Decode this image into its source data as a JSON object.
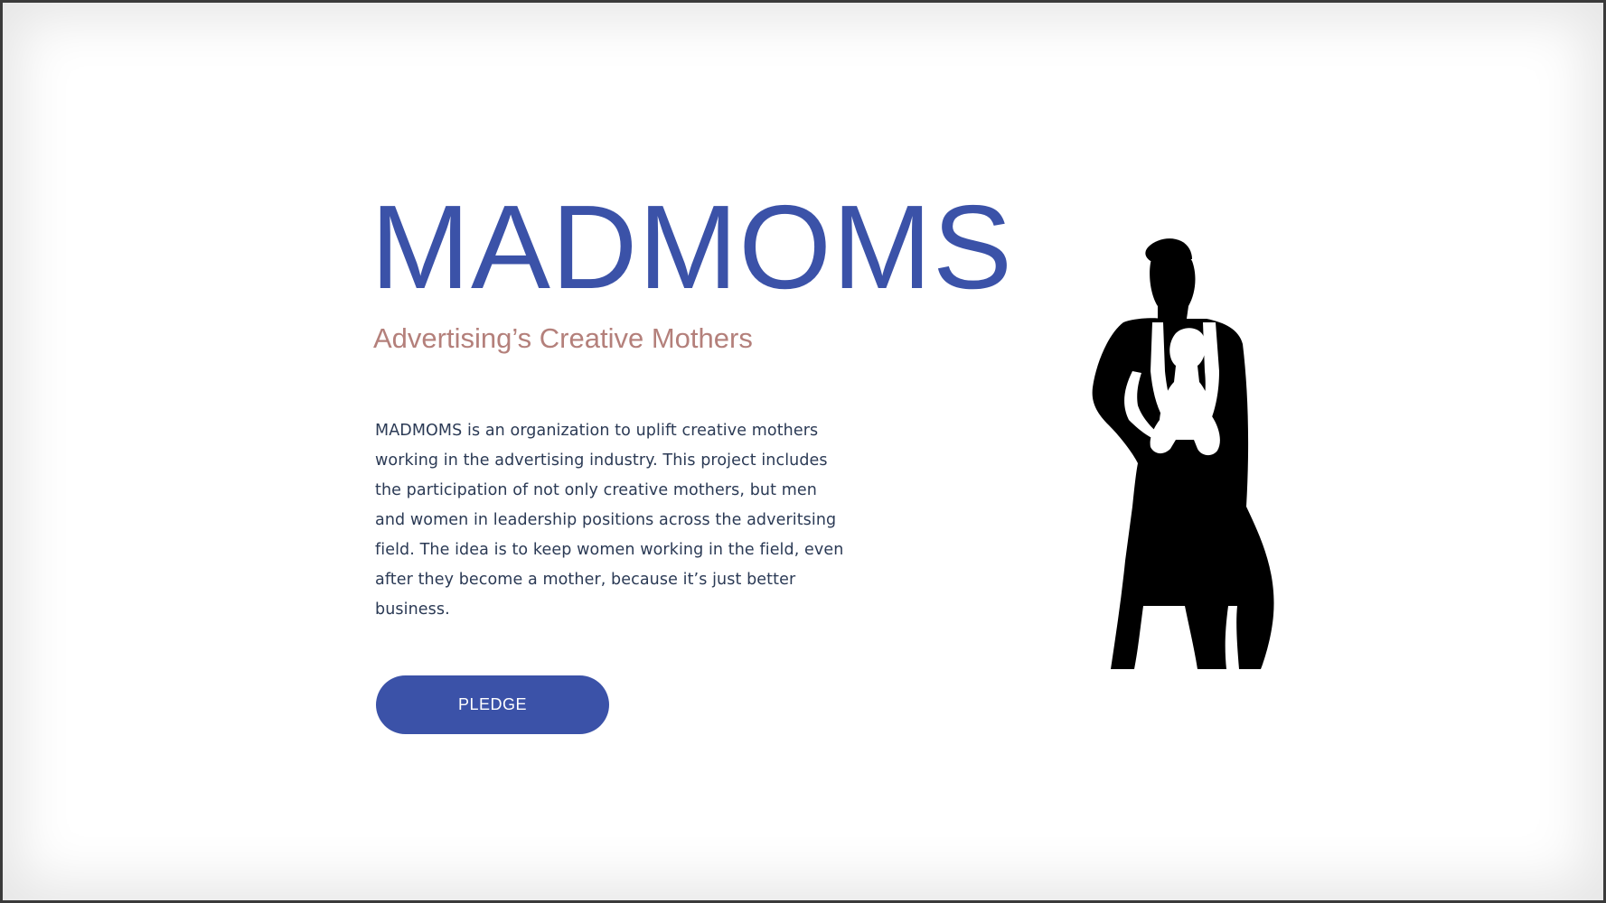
{
  "hero": {
    "title": "MADMOMS",
    "subtitle": "Advertising’s Creative Mothers",
    "description": "MADMOMS is an organization to uplift creative mothers working in the advertising industry. This project includes the participation of not only creative mothers, but men and women in leadership positions across the adveritsing field. The idea is to keep women working in the field, even after they become a mother, because it’s just better business.",
    "cta_label": "PLEDGE"
  },
  "illustration": {
    "icon": "mother-with-baby-carrier-silhouette"
  },
  "colors": {
    "title": "#3b52a8",
    "subtitle": "#b4807b",
    "body_text": "#2b3a55",
    "button_bg": "#3b52a8",
    "silhouette": "#000000",
    "page_bg": "#ffffff"
  }
}
